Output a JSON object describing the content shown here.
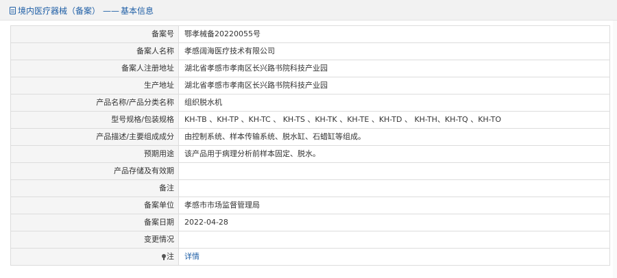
{
  "header": {
    "title": "境内医疗器械（备案）",
    "separator": "——",
    "subtitle": "基本信息"
  },
  "rows": [
    {
      "label": "备案号",
      "value": "鄂孝械备20220055号"
    },
    {
      "label": "备案人名称",
      "value": "孝感阔海医疗技术有限公司"
    },
    {
      "label": "备案人注册地址",
      "value": "湖北省孝感市孝南区长兴路书院科技产业园"
    },
    {
      "label": "生产地址",
      "value": "湖北省孝感市孝南区长兴路书院科技产业园"
    },
    {
      "label": "产品名称/产品分类名称",
      "value": "组织脱水机"
    },
    {
      "label": "型号规格/包装规格",
      "value": "KH-TB 、KH-TP 、KH-TC 、 KH-TS 、KH-TK 、KH-TE 、KH-TD 、 KH-TH、KH-TQ 、KH-TO"
    },
    {
      "label": "产品描述/主要组成成分",
      "value": "由控制系统、样本传输系统、脱水缸、石蜡缸等组成。"
    },
    {
      "label": "预期用途",
      "value": "该产品用于病理分析前样本固定、脱水。"
    },
    {
      "label": "产品存储及有效期",
      "value": ""
    },
    {
      "label": "备注",
      "value": ""
    },
    {
      "label": "备案单位",
      "value": "孝感市市场监督管理局"
    },
    {
      "label": "备案日期",
      "value": "2022-04-28"
    },
    {
      "label": "变更情况",
      "value": ""
    }
  ],
  "note_row": {
    "label": "注",
    "link_text": "详情"
  },
  "colors": {
    "accent": "#1f5fa6",
    "label_bg": "#f5f5f5",
    "border": "#dcdcdc"
  }
}
